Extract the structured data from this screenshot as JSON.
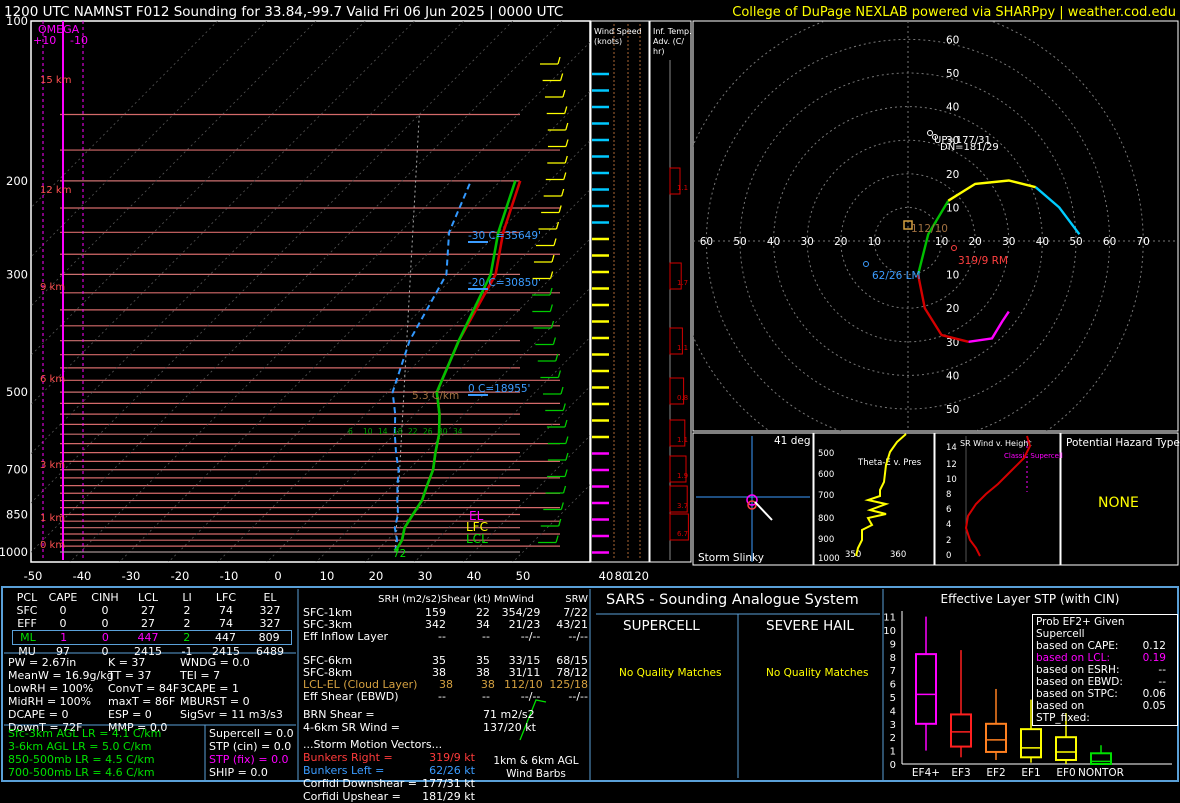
{
  "header": {
    "title": "1200 UTC NAMNST F012 Sounding for 33.84,-99.7 Valid  Fri 06 Jun 2025 | 0000 UTC",
    "credit": "College of DuPage NEXLAB powered via SHARPpy | weather.cod.edu"
  },
  "colors": {
    "bg": "#000000",
    "temp": "#d40000",
    "dewp": "#00c000",
    "wetbulb": "#00ccff",
    "virtual": "#d40000",
    "parcel": "#b0b0b0",
    "omega": "#ff00ff",
    "accent": "#ffff00",
    "border": "#5aa0d8"
  },
  "skewt": {
    "omega_label": "OMEGA",
    "omega_left": "+10",
    "omega_right": "-10",
    "pressure_ticks": [
      "100",
      "200",
      "300",
      "500",
      "700",
      "850",
      "1000"
    ],
    "temp_ticks": [
      "-50",
      "-40",
      "-30",
      "-20",
      "-10",
      "0",
      "10",
      "20",
      "30",
      "40",
      "50"
    ],
    "height_labels": [
      "15 km",
      "12 km",
      "9 km",
      "6 km",
      "3 km",
      "1 km",
      "0 km"
    ],
    "level_labels": [
      "-30 C=35649'",
      "-20 C=30850'",
      "0 C=18955'"
    ],
    "lapse_label": "5.3 C/km",
    "parcel_labels": [
      "EL",
      "LFC",
      "LCL"
    ],
    "sfc_temp_label": "72",
    "mix_labels": [
      "6",
      "10",
      "14",
      "18",
      "22",
      "26",
      "30",
      "34"
    ]
  },
  "wind_speed": {
    "title": "Wind Speed (knots)",
    "ticks": [
      "40",
      "80",
      "120"
    ]
  },
  "inf_temp": {
    "title": "Inf. Temp. Adv. (C/hr)",
    "values": [
      "1.1",
      "1.7",
      "1.1",
      "0.8",
      "1.1",
      "1.9",
      "3.7",
      "6.7"
    ]
  },
  "hodograph": {
    "rings": [
      "10",
      "20",
      "30",
      "40",
      "50",
      "60",
      "70"
    ],
    "y_labels": [
      "60",
      "50",
      "40",
      "30",
      "20",
      "10",
      "10",
      "20",
      "30",
      "40",
      "50",
      "60"
    ],
    "x_labels": [
      "70",
      "60",
      "50",
      "40",
      "30",
      "20",
      "10",
      "10",
      "20",
      "30",
      "40",
      "50",
      "60",
      "70"
    ],
    "rm_label": "319/9 RM",
    "lm_label": "62/26 LM",
    "mean_label": "112/10",
    "up_label": "UP=177/31",
    "dn_label": "DN=181/29"
  },
  "slinky": {
    "label": "Storm Slinky",
    "deg": "41 deg"
  },
  "theta": {
    "title": "Theta-E v. Pres",
    "y_ticks": [
      "500",
      "600",
      "700",
      "800",
      "900",
      "1000"
    ],
    "x_ticks": [
      "350",
      "360"
    ]
  },
  "srwind": {
    "title": "SR Wind v. Height",
    "y_ticks": [
      "14",
      "12",
      "10",
      "8",
      "6",
      "4",
      "2",
      "0"
    ],
    "label": "Classic Supercell"
  },
  "hazard": {
    "title": "Potential Hazard Type",
    "value": "NONE"
  },
  "parcels": {
    "headers": [
      "PCL",
      "CAPE",
      "CINH",
      "LCL",
      "LI",
      "LFC",
      "EL"
    ],
    "rows": [
      {
        "c": [
          "SFC",
          "0",
          "0",
          "27",
          "2",
          "74",
          "327"
        ]
      },
      {
        "c": [
          "EFF",
          "0",
          "0",
          "27",
          "2",
          "74",
          "327"
        ]
      },
      {
        "c": [
          "ML",
          "1",
          "0",
          "447",
          "2",
          "447",
          "809"
        ]
      },
      {
        "c": [
          "MU",
          "97",
          "0",
          "2415",
          "-1",
          "2415",
          "6489"
        ]
      }
    ]
  },
  "indices": {
    "col1": [
      "PW = 2.67in",
      "MeanW = 16.9g/kg",
      "LowRH = 100%",
      "MidRH = 100%",
      "DCAPE = 0",
      "DownT = 72F"
    ],
    "col2": [
      "K = 37",
      "TT = 37",
      "ConvT = 84F",
      "maxT = 86F",
      "ESP = 0",
      "MMP = 0.0"
    ],
    "col3": [
      "WNDG = 0.0",
      "TEI = 7",
      "3CAPE = 1",
      "MBURST = 0",
      "",
      "SigSvr = 11 m3/s3"
    ],
    "lapse": [
      "Sfc-3km AGL LR = 4.1 C/km",
      "3-6km AGL LR = 5.0 C/km",
      "850-500mb LR = 4.5 C/km",
      "700-500mb LR = 4.6 C/km"
    ],
    "comp": [
      "Supercell = 0.0",
      "STP (cin) = 0.0",
      "STP (fix) = 0.0",
      "SHIP = 0.0"
    ]
  },
  "kinematics": {
    "headers": [
      "SRH (m2/s2)",
      "Shear (kt)",
      "MnWind",
      "SRW"
    ],
    "rows": [
      {
        "c": [
          "SFC-1km",
          "159",
          "22",
          "354/29",
          "7/22"
        ]
      },
      {
        "c": [
          "SFC-3km",
          "342",
          "34",
          "21/23",
          "43/21"
        ]
      },
      {
        "c": [
          "Eff Inflow Layer",
          "--",
          "--",
          "--/--",
          "--/--"
        ]
      },
      {
        "c": [
          "",
          "",
          "",
          "",
          ""
        ]
      },
      {
        "c": [
          "SFC-6km",
          "35",
          "35",
          "33/15",
          "68/15"
        ]
      },
      {
        "c": [
          "SFC-8km",
          "38",
          "38",
          "31/11",
          "78/12"
        ]
      },
      {
        "c": [
          "LCL-EL (Cloud Layer)",
          "38",
          "38",
          "112/10",
          "125/18"
        ]
      },
      {
        "c": [
          "Eff Shear (EBWD)",
          "--",
          "--",
          "--/--",
          "--/--"
        ]
      }
    ],
    "brn": "BRN Shear = ",
    "brn_v": "71 m2/s2",
    "sr46": "4-6km SR Wind = ",
    "sr46_v": "137/20 kt",
    "smv": "...Storm Motion Vectors...",
    "br": "Bunkers Right = ",
    "br_v": "319/9 kt",
    "bl": "Bunkers Left = ",
    "bl_v": "62/26 kt",
    "cdn": "Corfidi Downshear = ",
    "cdn_v": "177/31 kt",
    "cup": "Corfidi Upshear = ",
    "cup_v": "181/29 kt",
    "barbs": "1km & 6km AGL Wind Barbs"
  },
  "sars": {
    "title": "SARS - Sounding Analogue System",
    "super": "SUPERCELL",
    "hail": "SEVERE HAIL",
    "none1": "No Quality Matches",
    "none2": "No Quality Matches"
  },
  "stp": {
    "title": "Effective Layer STP (with CIN)",
    "prob_title": "Prob EF2+ Given Supercell",
    "probs": [
      {
        "k": "based on CAPE:",
        "v": "0.12"
      },
      {
        "k": "based on LCL:",
        "v": "0.19"
      },
      {
        "k": "based on ESRH:",
        "v": "--"
      },
      {
        "k": "based on EBWD:",
        "v": "--"
      },
      {
        "k": "based on STPC:",
        "v": "0.06"
      },
      {
        "k": "based on STP_fixed:",
        "v": "0.05"
      }
    ],
    "y_ticks": [
      "0",
      "1",
      "2",
      "3",
      "4",
      "5",
      "6",
      "7",
      "8",
      "9",
      "10",
      "11"
    ]
  },
  "chart_data": [
    {
      "type": "line",
      "title": "1200 UTC NAMNST F012 Sounding for 33.84,-99.7",
      "xlabel": "",
      "ylabel": "",
      "series": [
        {
          "name": "temperature",
          "x": [
            24,
            23,
            21,
            20,
            19,
            17,
            15,
            12,
            9,
            5,
            0,
            -6,
            -12,
            -19,
            -26
          ],
          "y": [
            1000,
            950,
            900,
            850,
            800,
            750,
            700,
            650,
            600,
            550,
            500,
            400,
            300,
            250,
            200
          ]
        },
        {
          "name": "dewpoint",
          "x": [
            24,
            23,
            21,
            20,
            19,
            17,
            15,
            12,
            9,
            5,
            0,
            -6,
            -13,
            -20,
            -27
          ],
          "y": [
            1000,
            950,
            900,
            850,
            800,
            750,
            700,
            650,
            600,
            550,
            500,
            400,
            300,
            250,
            200
          ]
        },
        {
          "name": "wetbulb",
          "x": [
            24,
            22,
            19,
            17,
            14,
            11,
            8,
            4,
            0,
            -4,
            -9,
            -16,
            -22,
            -30,
            -36
          ],
          "y": [
            1000,
            950,
            900,
            850,
            800,
            750,
            700,
            650,
            600,
            550,
            500,
            400,
            300,
            250,
            200
          ]
        }
      ],
      "ylim": [
        1050,
        100
      ],
      "xlim": [
        -50,
        50
      ]
    },
    {
      "type": "line",
      "title": "Hodograph",
      "xlabel": "",
      "ylabel": "",
      "series": [
        {
          "name": "0-3km",
          "x": [
            30,
            28,
            25,
            18
          ],
          "y": [
            -21,
            -24,
            -29,
            -30
          ]
        },
        {
          "name": "3-6km",
          "x": [
            18,
            10,
            5,
            3
          ],
          "y": [
            -30,
            -28,
            -20,
            -10
          ]
        },
        {
          "name": "6-9km",
          "x": [
            3,
            6,
            12
          ],
          "y": [
            -10,
            2,
            12
          ]
        },
        {
          "name": "9-12km",
          "x": [
            12,
            20,
            30,
            38
          ],
          "y": [
            12,
            17,
            18,
            16
          ]
        },
        {
          "name": "12km+",
          "x": [
            38,
            45,
            51
          ],
          "y": [
            16,
            10,
            2
          ]
        }
      ]
    },
    {
      "type": "bar",
      "title": "Effective Layer STP (with CIN)",
      "categories": [
        "EF4+",
        "EF3",
        "EF2",
        "EF1",
        "EF0",
        "NONTOR"
      ],
      "values": [
        5.2,
        2.4,
        1.8,
        1.2,
        0.9,
        0.2
      ],
      "ylim": [
        0,
        11
      ]
    }
  ]
}
